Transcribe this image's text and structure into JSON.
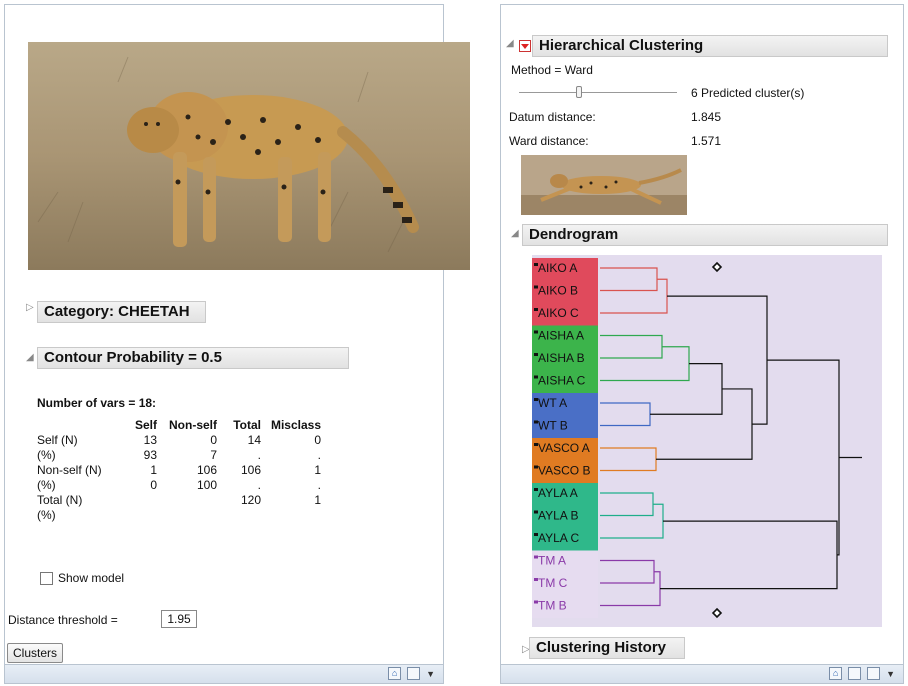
{
  "left": {
    "category_label": "Category: CHEETAH",
    "contour_title": "Contour Probability = 0.5",
    "number_of_vars": "Number of vars = 18:",
    "table": {
      "headers": [
        "",
        "Self",
        "Non-self",
        "Total",
        "Misclass"
      ],
      "rows": [
        [
          "Self (N)",
          "13",
          "0",
          "14",
          "0"
        ],
        [
          "(%)",
          "93",
          "7",
          ".",
          "."
        ],
        [
          "Non-self (N)",
          "1",
          "106",
          "106",
          "1"
        ],
        [
          "(%)",
          "0",
          "100",
          ".",
          "."
        ],
        [
          "Total (N)",
          "",
          "",
          "120",
          "1"
        ],
        [
          "(%)",
          "",
          "",
          "",
          ""
        ]
      ]
    },
    "show_model_label": "Show model",
    "distance_threshold_label": "Distance threshold =",
    "distance_threshold_value": "1.95",
    "clusters_button": "Clusters"
  },
  "right": {
    "hc_title": "Hierarchical Clustering",
    "method": "Method = Ward",
    "predicted_clusters": "6 Predicted cluster(s)",
    "datum_distance_label": "Datum distance:",
    "datum_distance_value": "1.845",
    "ward_distance_label": "Ward distance:",
    "ward_distance_value": "1.571",
    "dendrogram_title": "Dendrogram",
    "clustering_history_title": "Clustering History",
    "leaves": [
      {
        "label": "AIKO A",
        "group": 0
      },
      {
        "label": "AIKO B",
        "group": 0
      },
      {
        "label": "AIKO C",
        "group": 0
      },
      {
        "label": "AISHA A",
        "group": 1
      },
      {
        "label": "AISHA B",
        "group": 1
      },
      {
        "label": "AISHA C",
        "group": 1
      },
      {
        "label": "WT A",
        "group": 2
      },
      {
        "label": "WT B",
        "group": 2
      },
      {
        "label": "VASCO A",
        "group": 3
      },
      {
        "label": "VASCO B",
        "group": 3
      },
      {
        "label": "AYLA A",
        "group": 4
      },
      {
        "label": "AYLA B",
        "group": 4
      },
      {
        "label": "AYLA C",
        "group": 4
      },
      {
        "label": "TM A",
        "group": 5
      },
      {
        "label": "TM C",
        "group": 5
      },
      {
        "label": "TM B",
        "group": 5
      }
    ],
    "group_colors": [
      "#e04a5c",
      "#3cb44b",
      "#4a6fc6",
      "#e07b22",
      "#2fb88a",
      "#e6dcf0"
    ],
    "link_colors": [
      "#d9534f",
      "#2fa84f",
      "#3f68c4",
      "#e07b22",
      "#1fae8a",
      "#8a3aa8"
    ]
  },
  "icons": [
    "expand-triangle-icon",
    "collapse-triangle-icon",
    "red-triangle-menu-icon",
    "diamond-marker-icon",
    "home-icon",
    "window-icon",
    "dropdown-arrow-icon"
  ]
}
